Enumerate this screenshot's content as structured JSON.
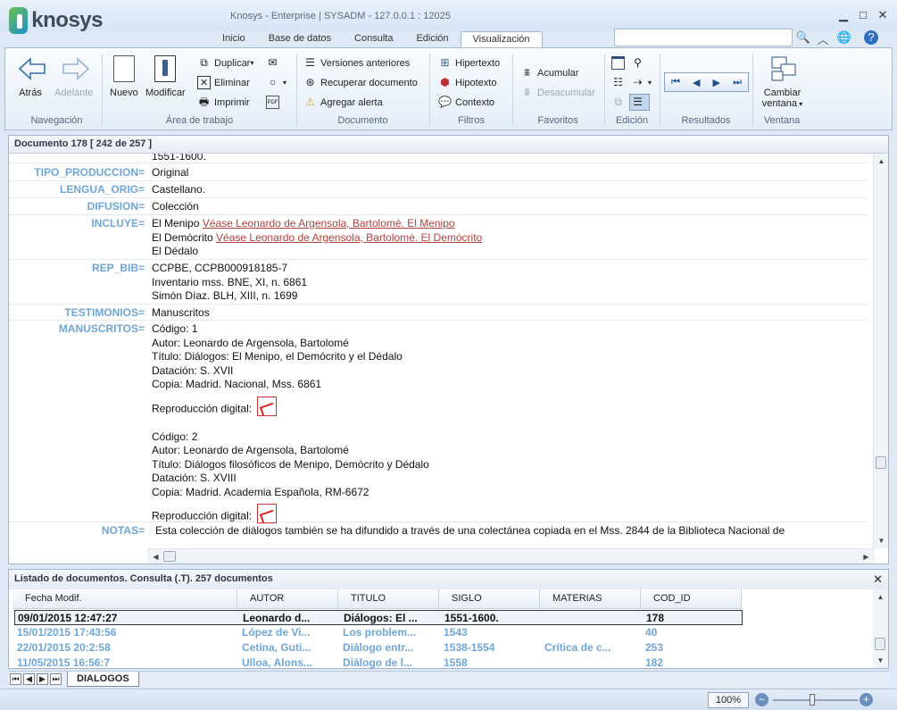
{
  "app": {
    "title": "Knosys - Enterprise  |  SYSADM - 127.0.0.1 : 12025",
    "logo": "knosys"
  },
  "tabs": [
    "Inicio",
    "Base de datos",
    "Consulta",
    "Edición",
    "Visualización"
  ],
  "active_tab": "Visualización",
  "ribbon": {
    "navegacion": {
      "label": "Navegación",
      "back": "Atrás",
      "forward": "Adelante"
    },
    "area": {
      "label": "Área de trabajo",
      "nuevo": "Nuevo",
      "modificar": "Modificar",
      "duplicar": "Duplicar",
      "eliminar": "Eliminar",
      "imprimir": "Imprimir"
    },
    "documento": {
      "label": "Documento",
      "versiones": "Versiones anteriores",
      "recuperar": "Recuperar documento",
      "alerta": "Agregar alerta"
    },
    "filtros": {
      "label": "Filtros",
      "hipertexto": "Hipertexto",
      "hipotexto": "Hipotexto",
      "contexto": "Contexto"
    },
    "favoritos": {
      "label": "Favoritos",
      "acumular": "Acumular",
      "desacumular": "Desacumular"
    },
    "edicion": {
      "label": "Edición"
    },
    "resultados": {
      "label": "Resultados"
    },
    "ventana": {
      "label": "Ventana",
      "cambiar": "Cambiar",
      "ventana": "ventana"
    }
  },
  "document": {
    "header": "Documento 178  [ 242 de 257 ]",
    "partial_top": "1551-1600.",
    "fields": [
      {
        "name": "TIPO_PRODUCCION=",
        "lines": [
          "Original"
        ]
      },
      {
        "name": "LENGUA_ORIG=",
        "lines": [
          "Castellano."
        ]
      },
      {
        "name": "DIFUSION=",
        "lines": [
          "Colección"
        ]
      },
      {
        "name": "INCLUYE=",
        "lines": [
          "El Menipo",
          "El Demócrito",
          "El Dédalo"
        ],
        "links": [
          "Véase Leonardo de Argensola, Bartolomé. El Menipo",
          "Véase Leonardo de Argensola, Bartolomé. El Demócrito"
        ]
      },
      {
        "name": "REP_BIB=",
        "lines": [
          "CCPBE, CCPB000918185-7",
          "Inventario mss. BNE, XI, n. 6861",
          "Simón Díaz. BLH, XIII, n. 1699"
        ]
      },
      {
        "name": "TESTIMONIOS=",
        "lines": [
          "Manuscritos"
        ]
      },
      {
        "name": "MANUSCRITOS=",
        "lines": [
          "Código: 1",
          "Autor: Leonardo de Argensola, Bartolomé",
          "Título: Diálogos: El Menipo, el Demócrito y el Dédalo",
          "Datación: S. XVII",
          "Copia: Madrid. Nacional, Mss. 6861",
          "Reproducción digital:",
          "Código: 2",
          "Autor: Leonardo de Argensola, Bartolomé",
          "Título: Diálogos filosóficos de Menipo, Demócrito y Dédalo",
          "Datación: S. XVIII",
          "Copia: Madrid. Academia Española, RM-6672",
          "Reproducción digital:"
        ]
      },
      {
        "name": "NOTAS=",
        "lines": [
          "Esta colección de diálogos también se ha difundido a través de una colectánea copiada en el Mss. 2844 de la Biblioteca Nacional de"
        ]
      }
    ]
  },
  "list": {
    "header": "Listado de documentos. Consulta  (.T). 257 documentos",
    "columns": [
      "Fecha Modif.",
      "AUTOR",
      "TITULO",
      "SIGLO",
      "MATERIAS",
      "COD_ID"
    ],
    "rows": [
      [
        "09/01/2015 12:47:27",
        "Leonardo d...",
        "Diálogos: El ...",
        "1551-1600.",
        "",
        "178"
      ],
      [
        "15/01/2015 17:43:56",
        "López de Vi...",
        "Los problem...",
        "1543",
        "",
        "40"
      ],
      [
        "22/01/2015 20:2:58",
        "Cetina, Guti...",
        "Diálogo entr...",
        "1538-1554",
        "Crítica de c...",
        "253"
      ],
      [
        "11/05/2015 16:56:7",
        "Ulloa, Alons...",
        "Diálogo de l...",
        "1558",
        "",
        "182"
      ]
    ],
    "sheet_tab": "DIALOGOS"
  },
  "status": {
    "zoom": "100%"
  },
  "colors": {
    "field_name": "#6fa6d8",
    "link": "#b0433d",
    "row_alt": "#6fa6d8"
  }
}
